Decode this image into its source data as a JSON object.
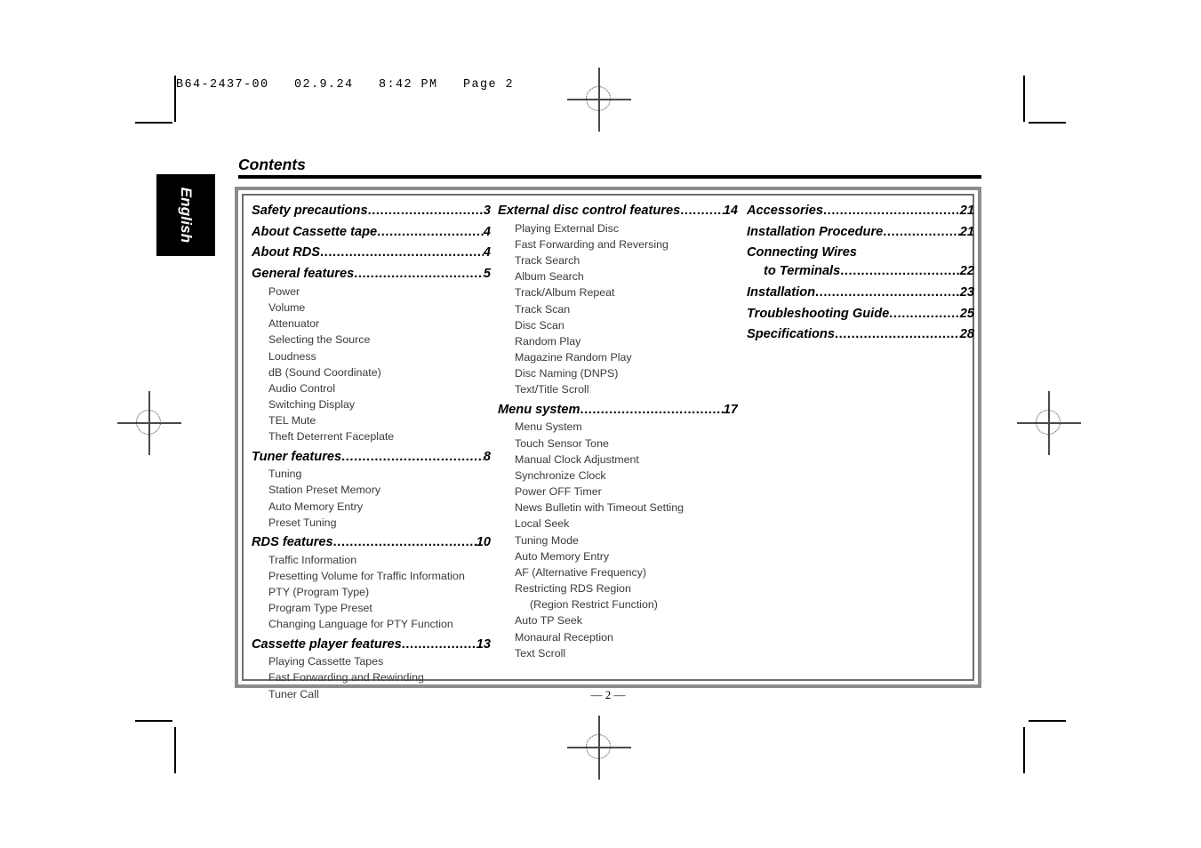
{
  "file_header": "B64-2437-00   02.9.24   8:42 PM   Page 2",
  "language_tab": "English",
  "page_title": "Contents",
  "footer": "— 2 —",
  "leader_char": ".",
  "colors": {
    "frame_outer": "#8c8c8c",
    "frame_inner": "#6e6e6e",
    "heading_text": "#000000",
    "sub_text": "#3a3a3a",
    "tab_background": "#000000",
    "tab_text": "#ffffff"
  },
  "columns": [
    {
      "entries": [
        {
          "kind": "heading",
          "title": "Safety precautions",
          "page": "3",
          "subs": []
        },
        {
          "kind": "heading",
          "title": "About Cassette tape",
          "page": "4",
          "subs": []
        },
        {
          "kind": "heading",
          "title": "About RDS",
          "page": "4",
          "subs": []
        },
        {
          "kind": "heading",
          "title": "General features",
          "page": "5",
          "subs": [
            "Power",
            "Volume",
            "Attenuator",
            "Selecting the Source",
            "Loudness",
            "dB (Sound Coordinate)",
            "Audio Control",
            "Switching Display",
            "TEL Mute",
            "Theft Deterrent Faceplate"
          ]
        },
        {
          "kind": "heading",
          "title": "Tuner features",
          "page": "8",
          "subs": [
            "Tuning",
            "Station Preset Memory",
            "Auto Memory Entry",
            "Preset Tuning"
          ]
        },
        {
          "kind": "heading",
          "title": "RDS features",
          "page": "10",
          "subs": [
            "Traffic Information",
            "Presetting Volume for Traffic Information",
            "PTY (Program Type)",
            "Program Type Preset",
            "Changing Language for PTY Function"
          ]
        },
        {
          "kind": "heading",
          "title": "Cassette player features",
          "page": "13",
          "subs": [
            "Playing Cassette Tapes",
            "Fast Forwarding and Rewinding",
            "Tuner Call"
          ]
        }
      ]
    },
    {
      "entries": [
        {
          "kind": "heading",
          "title": "External disc control features",
          "page": "14",
          "subs": [
            "Playing External Disc",
            "Fast Forwarding and Reversing",
            "Track Search",
            "Album Search",
            "Track/Album Repeat",
            "Track Scan",
            "Disc Scan",
            "Random Play",
            "Magazine Random Play",
            "Disc Naming (DNPS)",
            "Text/Title Scroll"
          ]
        },
        {
          "kind": "heading",
          "title": "Menu system",
          "page": "17",
          "subs": [
            "Menu System",
            "Touch Sensor Tone",
            "Manual Clock Adjustment",
            "Synchronize Clock",
            "Power OFF Timer",
            "News Bulletin with Timeout Setting",
            "Local Seek",
            "Tuning Mode",
            "Auto Memory Entry",
            "AF (Alternative Frequency)",
            "Restricting RDS Region",
            "(Region Restrict Function)",
            "Auto TP Seek",
            "Monaural Reception",
            "Text Scroll"
          ],
          "sub_extra_indent": [
            11
          ]
        }
      ]
    },
    {
      "entries": [
        {
          "kind": "heading",
          "title": "Accessories",
          "page": "21",
          "subs": []
        },
        {
          "kind": "heading",
          "title": "Installation Procedure",
          "page": "21",
          "subs": []
        },
        {
          "kind": "heading-nopage",
          "title": "Connecting Wires",
          "page": "",
          "subs": []
        },
        {
          "kind": "heading-cont",
          "title": "to Terminals",
          "page": "22",
          "subs": []
        },
        {
          "kind": "heading",
          "title": "Installation",
          "page": "23",
          "subs": []
        },
        {
          "kind": "heading",
          "title": "Troubleshooting Guide",
          "page": "25",
          "subs": []
        },
        {
          "kind": "heading",
          "title": "Specifications",
          "page": "28",
          "subs": []
        }
      ]
    }
  ]
}
